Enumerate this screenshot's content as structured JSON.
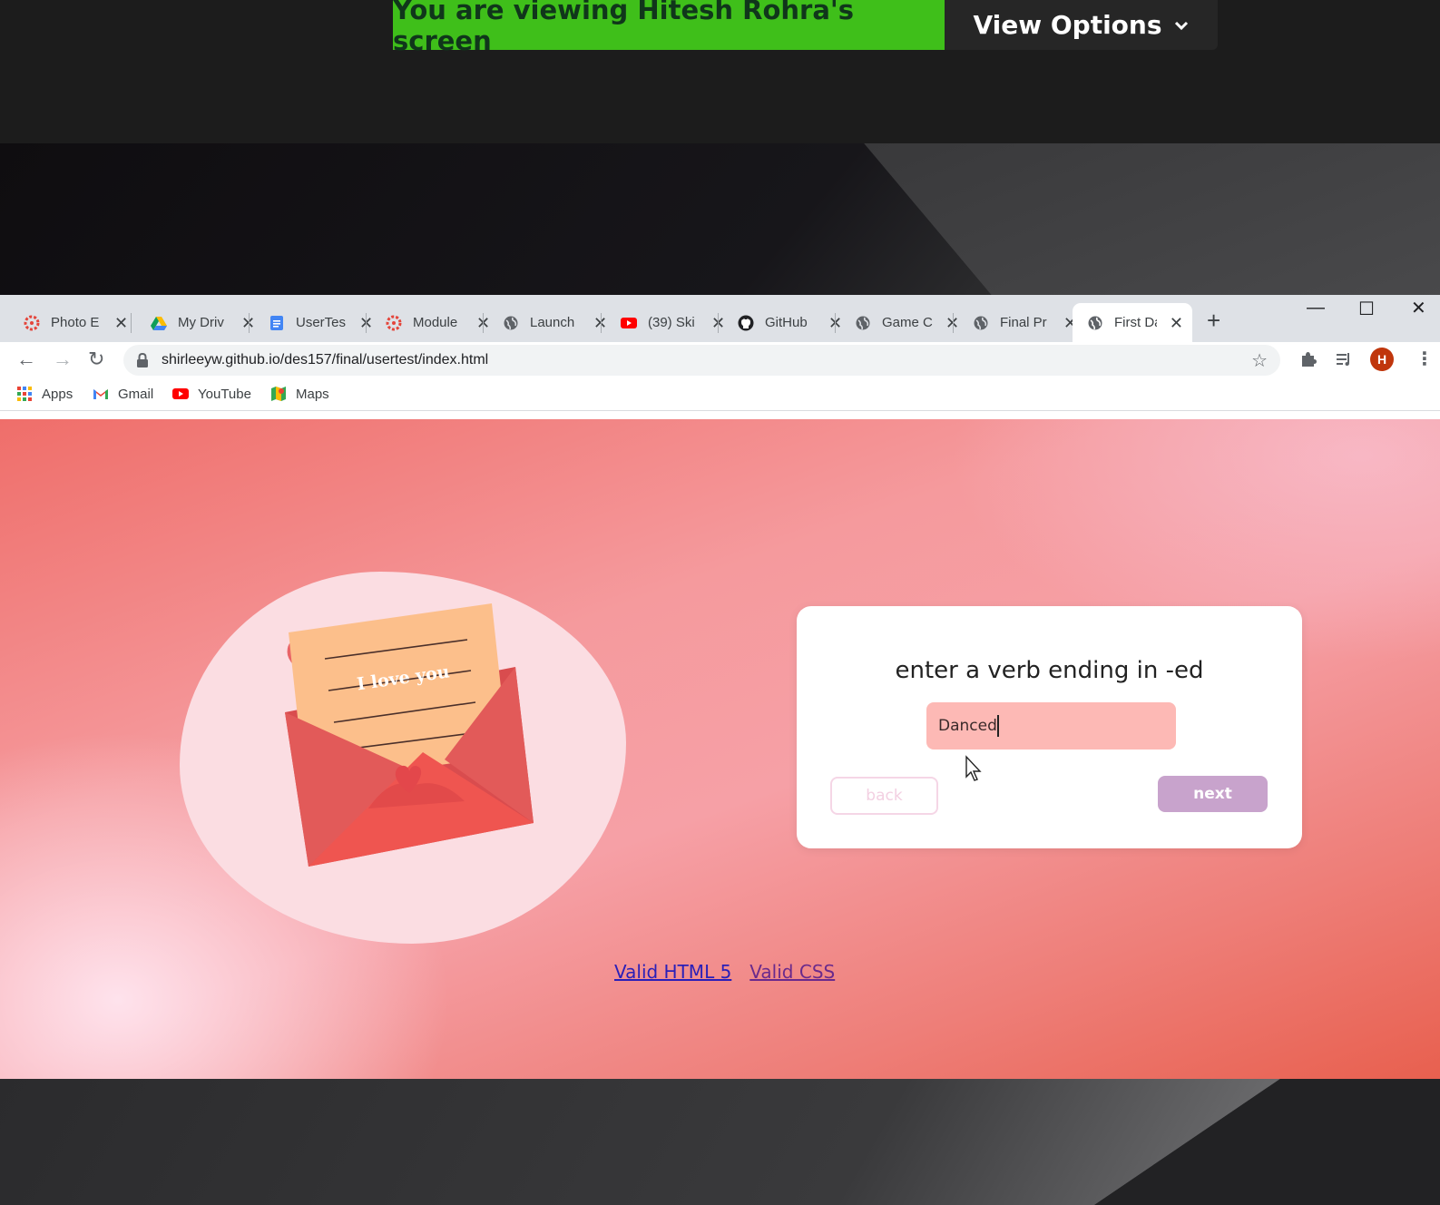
{
  "zoom": {
    "banner_text": "You are viewing Hitesh Rohra's screen",
    "view_options_label": "View Options",
    "banner_color": "#3fbf1a"
  },
  "browser": {
    "tabs": [
      {
        "label": "Photo E",
        "icon": "canvas-icon"
      },
      {
        "label": "My Driv",
        "icon": "google-drive-icon"
      },
      {
        "label": "UserTes",
        "icon": "google-docs-icon"
      },
      {
        "label": "Module",
        "icon": "canvas-icon"
      },
      {
        "label": "Launch",
        "icon": "globe-icon"
      },
      {
        "label": "(39) Ski",
        "icon": "youtube-icon"
      },
      {
        "label": "GitHub",
        "icon": "github-icon"
      },
      {
        "label": "Game C",
        "icon": "globe-icon"
      },
      {
        "label": "Final Pr",
        "icon": "globe-icon"
      },
      {
        "label": "First Da",
        "icon": "globe-icon",
        "active": true
      }
    ],
    "new_tab_symbol": "+",
    "url": "shirleeyw.github.io/des157/final/usertest/index.html",
    "profile_initial": "H",
    "bookmarks": [
      {
        "label": "Apps",
        "icon": "apps-grid-icon"
      },
      {
        "label": "Gmail",
        "icon": "gmail-icon"
      },
      {
        "label": "YouTube",
        "icon": "youtube-icon"
      },
      {
        "label": "Maps",
        "icon": "maps-icon"
      }
    ]
  },
  "page": {
    "prompt": "enter a verb ending in -ed",
    "input_value": "Danced",
    "back_label": "back",
    "next_label": "next",
    "illustration_text": "I love you",
    "footer_links": [
      "Valid HTML 5",
      "Valid CSS"
    ]
  },
  "colors": {
    "page_gradient_start": "#ef6e6a",
    "page_gradient_end": "#e8604f",
    "input_bg": "#fdb9b5",
    "next_button": "#c8a3cc"
  }
}
